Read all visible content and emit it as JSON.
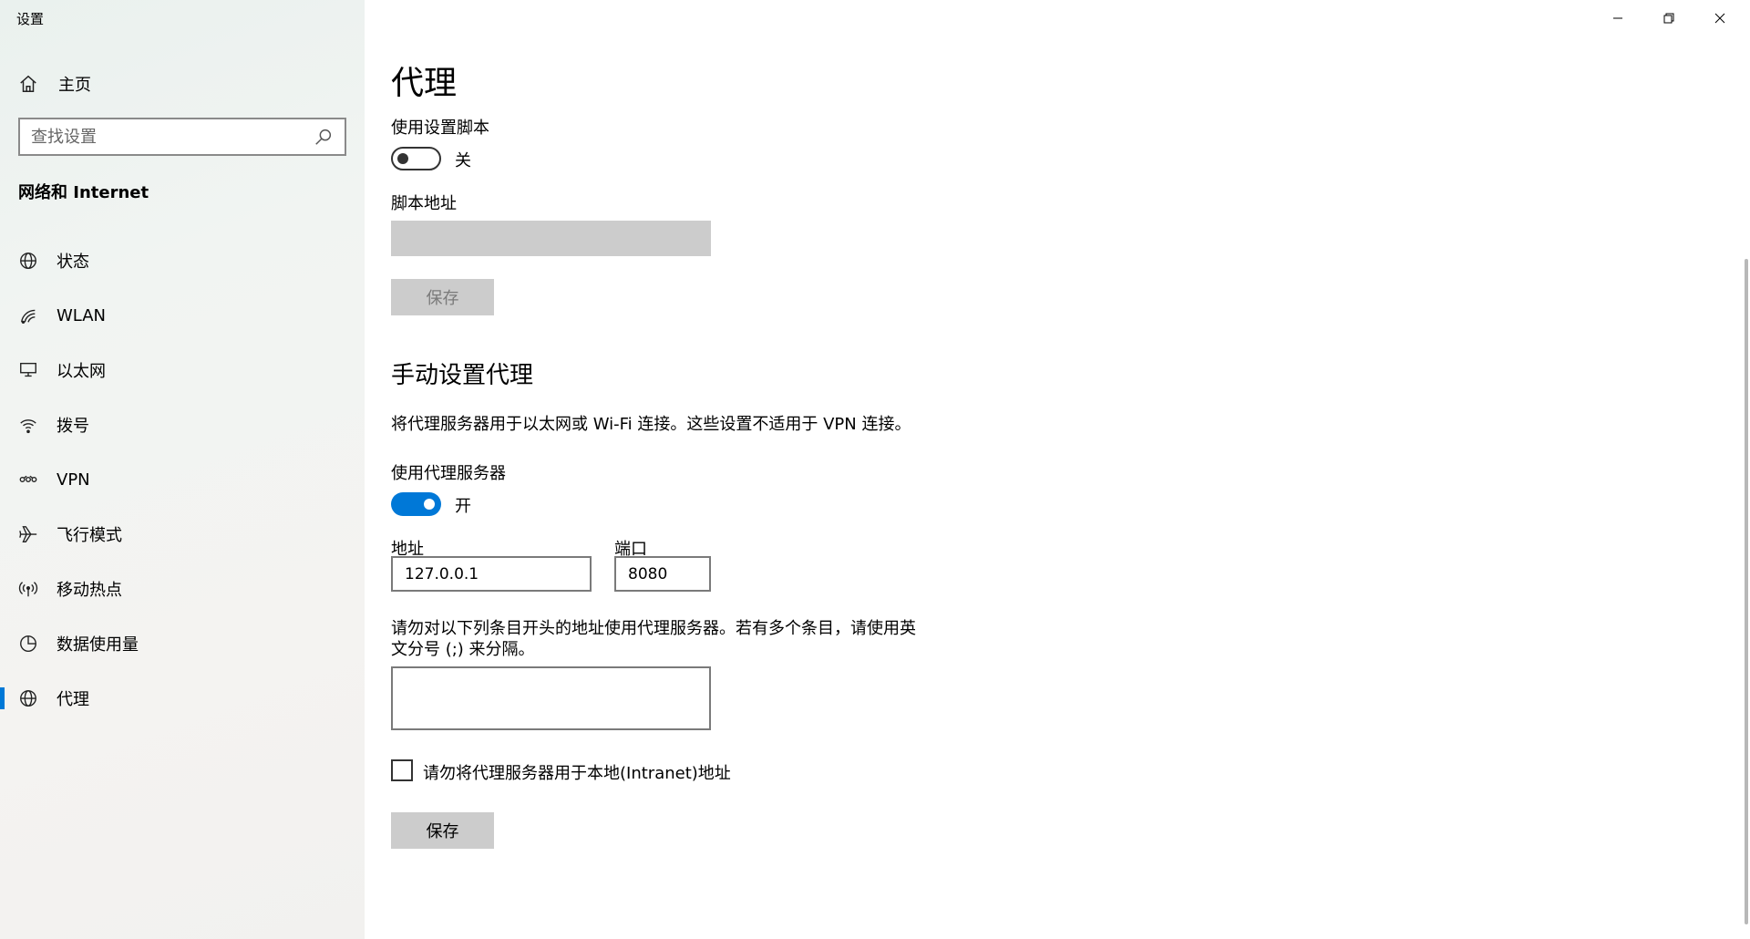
{
  "app": {
    "title": "设置"
  },
  "window_controls": {
    "minimize": "minimize-icon",
    "restore": "restore-icon",
    "close": "close-icon"
  },
  "sidebar": {
    "home_label": "主页",
    "search_placeholder": "查找设置",
    "section_title": "网络和 Internet",
    "items": [
      {
        "label": "状态",
        "icon": "globe-status-icon"
      },
      {
        "label": "WLAN",
        "icon": "wifi-icon"
      },
      {
        "label": "以太网",
        "icon": "ethernet-icon"
      },
      {
        "label": "拨号",
        "icon": "dialup-icon"
      },
      {
        "label": "VPN",
        "icon": "vpn-icon"
      },
      {
        "label": "飞行模式",
        "icon": "airplane-icon"
      },
      {
        "label": "移动热点",
        "icon": "hotspot-icon"
      },
      {
        "label": "数据使用量",
        "icon": "data-usage-icon"
      },
      {
        "label": "代理",
        "icon": "globe-icon",
        "active": true
      }
    ]
  },
  "main": {
    "title": "代理",
    "auto": {
      "use_script_label": "使用设置脚本",
      "use_script_state": "关",
      "use_script_on": false,
      "script_address_label": "脚本地址",
      "script_address_value": "",
      "save_label": "保存"
    },
    "manual": {
      "title": "手动设置代理",
      "description": "将代理服务器用于以太网或 Wi-Fi 连接。这些设置不适用于 VPN 连接。",
      "use_proxy_label": "使用代理服务器",
      "use_proxy_state": "开",
      "use_proxy_on": true,
      "address_label": "地址",
      "address_value": "127.0.0.1",
      "port_label": "端口",
      "port_value": "8080",
      "exceptions_line1": "请勿对以下列条目开头的地址使用代理服务器。若有多个条目，请使用英",
      "exceptions_line2": "文分号 (;) 来分隔。",
      "exceptions_value": "",
      "bypass_local_label": "请勿将代理服务器用于本地(Intranet)地址",
      "bypass_local_checked": false,
      "save_label": "保存"
    }
  },
  "colors": {
    "accent": "#0078d7",
    "disabled": "#cccccc"
  }
}
